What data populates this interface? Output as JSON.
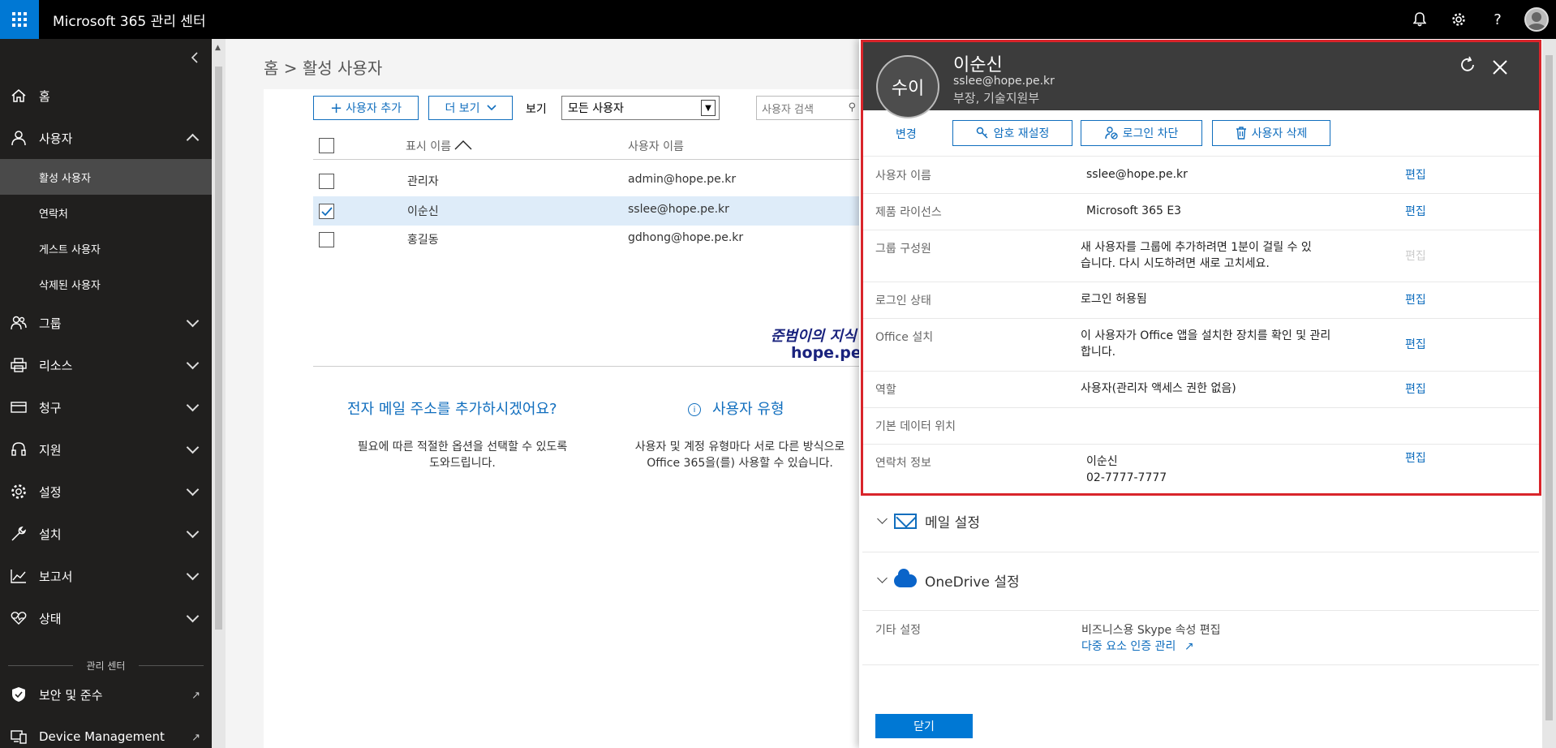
{
  "app": {
    "title": "Microsoft 365 관리 센터"
  },
  "topbar": {
    "icons": [
      "bell-icon",
      "gear-icon",
      "help-icon",
      "user-avatar-icon"
    ],
    "help_glyph": "?"
  },
  "sidebar": {
    "items": [
      {
        "label": "홈",
        "icon": "home-icon"
      },
      {
        "label": "사용자",
        "icon": "person-icon"
      },
      {
        "label": "그룹",
        "icon": "group-icon"
      },
      {
        "label": "리소스",
        "icon": "printer-icon"
      },
      {
        "label": "청구",
        "icon": "card-icon"
      },
      {
        "label": "지원",
        "icon": "headset-icon"
      },
      {
        "label": "설정",
        "icon": "gear-icon"
      },
      {
        "label": "설치",
        "icon": "wrench-icon"
      },
      {
        "label": "보고서",
        "icon": "chart-icon"
      },
      {
        "label": "상태",
        "icon": "heart-icon"
      }
    ],
    "sub_items": [
      "활성 사용자",
      "연락처",
      "게스트 사용자",
      "삭제된 사용자"
    ],
    "divider": "관리 센터",
    "bottom_items": [
      {
        "label": "보안 및 준수",
        "icon": "shield-icon"
      },
      {
        "label": "Device Management",
        "icon": "device-icon"
      }
    ]
  },
  "main": {
    "breadcrumb": "홈 > 활성 사용자",
    "toolbar": {
      "add_user": "사용자 추가",
      "more": "더 보기",
      "view_label": "보기",
      "view_value": "모든 사용자",
      "search_placeholder": "사용자 검색"
    },
    "columns": {
      "display_name": "표시 이름",
      "user_name": "사용자 이름"
    },
    "rows": [
      {
        "display_name": "관리자",
        "user_name": "admin@hope.pe.kr",
        "checked": false
      },
      {
        "display_name": "이순신",
        "user_name": "sslee@hope.pe.kr",
        "checked": true
      },
      {
        "display_name": "홍길동",
        "user_name": "gdhong@hope.pe.kr",
        "checked": false
      }
    ],
    "watermark": {
      "line1": "준범이의 지식 창고",
      "line2": "hope.pe.kr"
    },
    "promo_email": {
      "title": "전자 메일 주소를 추가하시겠어요?",
      "text1": "필요에 따른 적절한 옵션을 선택할 수 있도록",
      "text2": "도와드립니다."
    },
    "promo_usertype": {
      "title": "사용자 유형",
      "text1": "사용자 및 계정 유형마다 서로 다른 방식으로",
      "text2": "Office 365을(를) 사용할 수 있습니다."
    }
  },
  "panel": {
    "avatar_initials": "수이",
    "name": "이순신",
    "email": "sslee@hope.pe.kr",
    "title": "부장, 기술지원부",
    "change": "변경",
    "buttons": {
      "reset_password": "암호 재설정",
      "block_signin": "로그인 차단",
      "delete_user": "사용자 삭제"
    },
    "edit": "편집",
    "properties": [
      {
        "label": "사용자 이름",
        "value": "sslee@hope.pe.kr"
      },
      {
        "label": "제품 라이선스",
        "value": "Microsoft 365 E3"
      },
      {
        "label": "그룹 구성원",
        "value1": "새 사용자를 그룹에 추가하려면 1분이 걸릴 수 있",
        "value2": "습니다. 다시 시도하려면 새로 고치세요."
      },
      {
        "label": "로그인 상태",
        "value": "로그인 허용됨"
      },
      {
        "label": "Office 설치",
        "value1": "이 사용자가 Office 앱을 설치한 장치를 확인 및 관리",
        "value2": "합니다."
      },
      {
        "label": "역할",
        "value": "사용자(관리자 액세스 권한 없음)"
      },
      {
        "label": "기본 데이터 위치",
        "value": ""
      },
      {
        "label": "연락처 정보",
        "value1": "이순신",
        "value2": "02-7777-7777"
      }
    ],
    "mail_settings": "메일 설정",
    "onedrive_settings": "OneDrive 설정",
    "other": {
      "label": "기타 설정",
      "skype": "비즈니스용 Skype 속성 편집",
      "mfa": "다중 요소 인증 관리"
    },
    "close": "닫기"
  },
  "colors": {
    "accent": "#0078d4",
    "link": "#106ebe",
    "highlight_frame": "#d9252b",
    "selected_row": "#deecf9"
  }
}
